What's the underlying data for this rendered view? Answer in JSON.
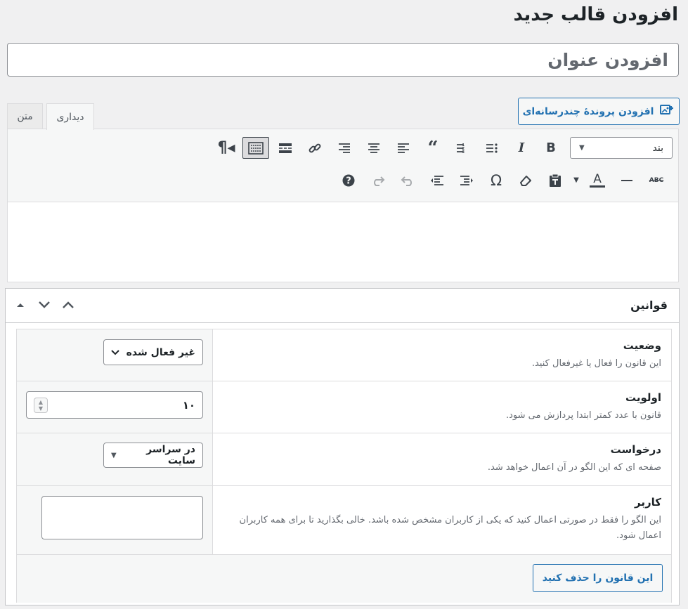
{
  "page": {
    "title": "افزودن قالب جدید"
  },
  "title_field": {
    "placeholder": "افزودن عنوان"
  },
  "media_button": {
    "label": "افزودن پروندهٔ چندرسانه‌ای",
    "icon": "media-add-icon"
  },
  "editor_tabs": [
    {
      "label": "دیداری"
    },
    {
      "label": "متن"
    }
  ],
  "toolbar": {
    "format_select": {
      "value": "بند"
    },
    "row1": [
      "bold",
      "italic",
      "bullet-list",
      "numbered-list",
      "blockquote",
      "align-left",
      "align-center",
      "align-right",
      "link",
      "read-more",
      "toolbar-toggle",
      "rtl"
    ],
    "row2": [
      "strikethrough",
      "horizontal-line",
      "text-color",
      "paste-as-text",
      "clear-formatting",
      "special-character",
      "outdent",
      "indent",
      "undo",
      "redo",
      "help"
    ]
  },
  "metabox": {
    "title": "قوانین",
    "rules": {
      "status": {
        "label": "وضعیت",
        "description": "این قانون را فعال یا غیرفعال کنید.",
        "value": "غیر فعال شده"
      },
      "priority": {
        "label": "اولویت",
        "description": "قانون با عدد کمتر ابتدا پردازش می شود.",
        "value": "۱۰"
      },
      "request": {
        "label": "درخواست",
        "description": "صفحه ای که این الگو در آن اعمال خواهد شد.",
        "value": "در سراسر سایت"
      },
      "user": {
        "label": "کاربر",
        "description": "این الگو را فقط در صورتی اعمال کنید که یکی از کاربران مشخص شده باشد. خالی بگذارید تا برای همه کاربران اعمال شود.",
        "value": ""
      },
      "delete_label": "این قانون را حذف کنید"
    }
  },
  "colors": {
    "accent": "#2271b1",
    "background": "#f0f0f1",
    "text": "#1d2327",
    "muted": "#646970"
  }
}
